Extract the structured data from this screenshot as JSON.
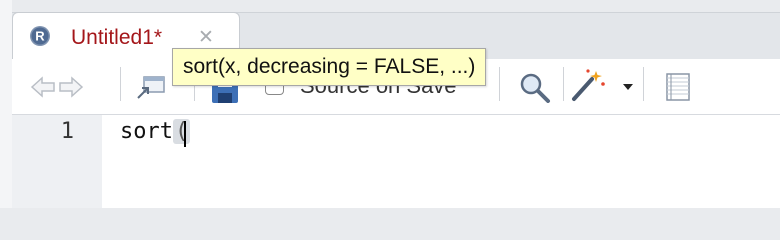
{
  "tab": {
    "title": "Untitled1*",
    "close_glyph": "✕",
    "icon": "r-file-icon",
    "title_color": "#a4161a"
  },
  "toolbar": {
    "source_on_save_label": "Source on Save",
    "source_on_save_checked": false,
    "icons": [
      "back-arrow-icon",
      "forward-arrow-icon",
      "show-in-window-icon",
      "save-icon",
      "search-icon",
      "magic-wand-icon",
      "dropdown-caret-icon",
      "compile-report-icon"
    ]
  },
  "editor": {
    "line_number": "1",
    "code_prefix": "sort",
    "code_paren": "("
  },
  "tooltip": {
    "text": "sort(x, decreasing = FALSE, ...)"
  }
}
